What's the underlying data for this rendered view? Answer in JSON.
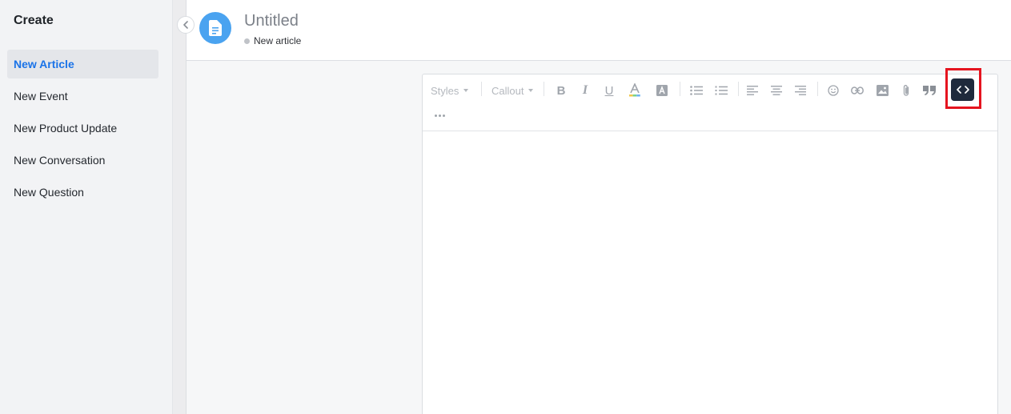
{
  "sidebar": {
    "title": "Create",
    "items": [
      {
        "label": "New Article",
        "active": true
      },
      {
        "label": "New Event"
      },
      {
        "label": "New Product Update"
      },
      {
        "label": "New Conversation"
      },
      {
        "label": "New Question"
      }
    ]
  },
  "header": {
    "title": "Untitled",
    "status": "New article",
    "avatar_icon": "document-icon",
    "avatar_color": "#4aa3f0"
  },
  "toolbar": {
    "styles_label": "Styles",
    "callout_label": "Callout",
    "icons": [
      "bold-icon",
      "italic-icon",
      "underline-icon",
      "text-color-icon",
      "highlight-icon",
      "bullet-list-icon",
      "numbered-list-icon",
      "align-left-icon",
      "align-center-icon",
      "align-right-icon",
      "emoji-icon",
      "link-icon",
      "image-icon",
      "attachment-icon",
      "quote-icon",
      "code-icon",
      "more-icon"
    ],
    "code_button_color": "#1f2a3c",
    "highlight_color": "#e5141f"
  },
  "colors": {
    "accent": "#1a73e8"
  }
}
